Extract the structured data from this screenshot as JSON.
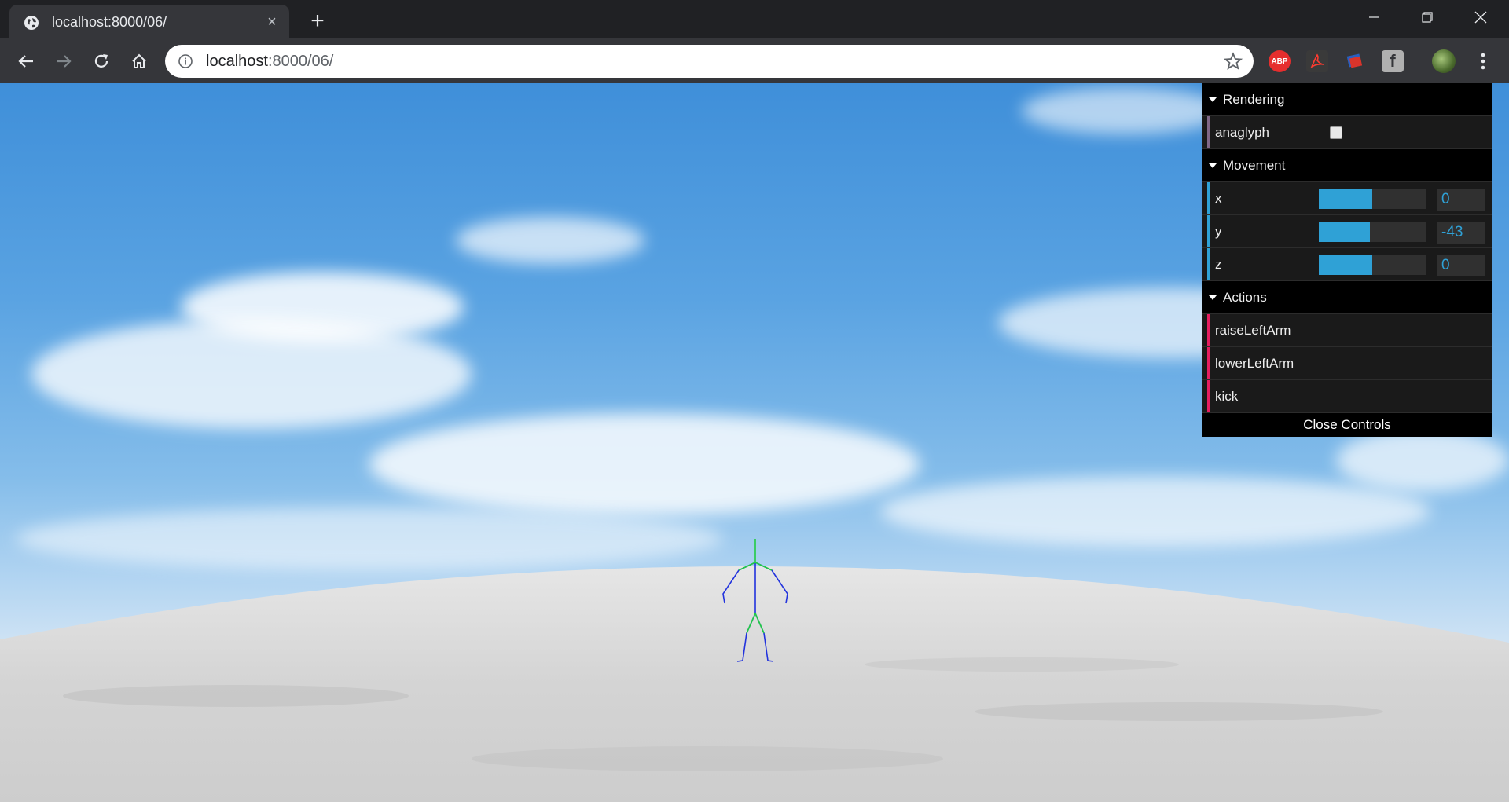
{
  "tab": {
    "title": "localhost:8000/06/",
    "favicon": "globe-icon"
  },
  "address_bar": {
    "host": "localhost",
    "path": ":8000/06/"
  },
  "extensions": {
    "abp_label": "ABP",
    "fb_label": "f"
  },
  "gui": {
    "folders": [
      {
        "title": "Rendering",
        "controllers": [
          {
            "label": "anaglyph",
            "type": "boolean",
            "checked": false
          }
        ]
      },
      {
        "title": "Movement",
        "controllers": [
          {
            "label": "x",
            "type": "number",
            "value": "0",
            "fill": 0.5
          },
          {
            "label": "y",
            "type": "number",
            "value": "-43",
            "fill": 0.48
          },
          {
            "label": "z",
            "type": "number",
            "value": "0",
            "fill": 0.5
          }
        ]
      },
      {
        "title": "Actions",
        "controllers": [
          {
            "label": "raiseLeftArm",
            "type": "function"
          },
          {
            "label": "lowerLeftArm",
            "type": "function"
          },
          {
            "label": "kick",
            "type": "function"
          }
        ]
      }
    ],
    "close_label": "Close Controls"
  },
  "colors": {
    "slider": "#2fa1d6",
    "boolean_accent": "#806787",
    "function_accent": "#e61d5f",
    "sky": "#5aa3e2",
    "ground": "#d8d8d8",
    "figure_blue": "#2233dd",
    "figure_green": "#22cc44"
  }
}
